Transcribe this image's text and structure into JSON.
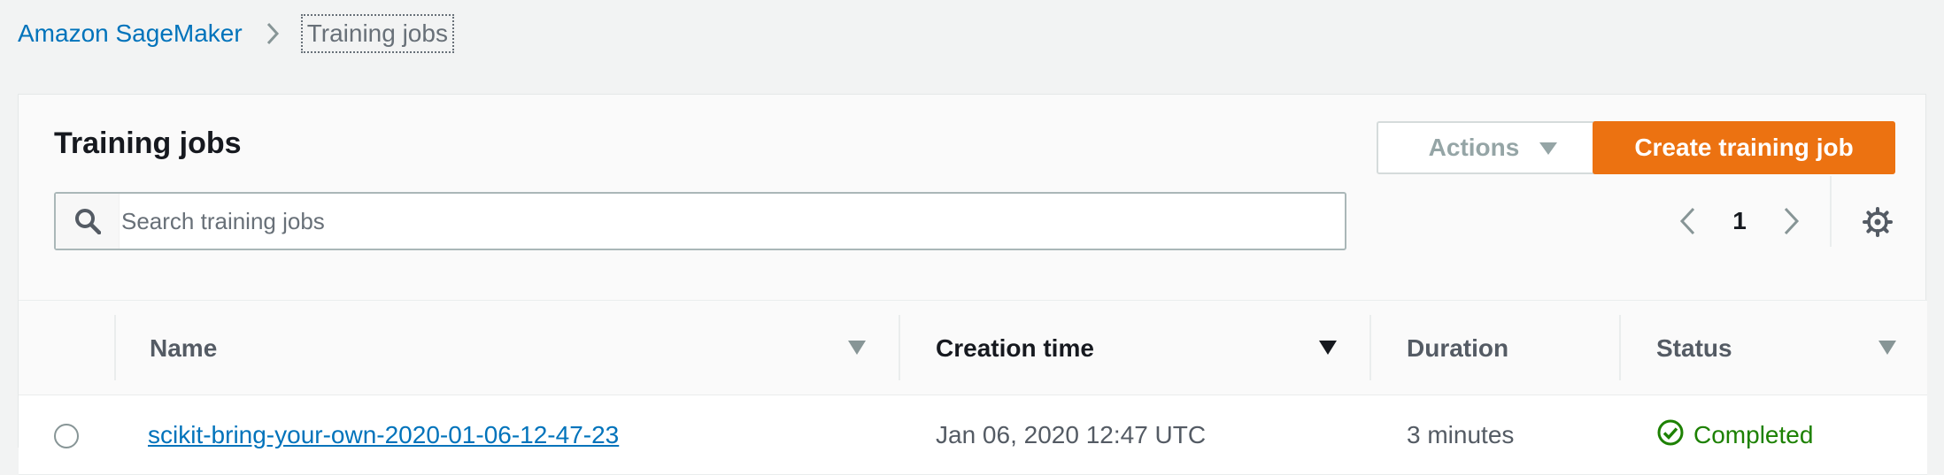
{
  "breadcrumb": {
    "root": "Amazon SageMaker",
    "current": "Training jobs"
  },
  "panel": {
    "title": "Training jobs",
    "actions_label": "Actions",
    "create_label": "Create training job"
  },
  "search": {
    "placeholder": "Search training jobs",
    "value": ""
  },
  "pagination": {
    "current_page": "1"
  },
  "table": {
    "columns": [
      "Name",
      "Creation time",
      "Duration",
      "Status"
    ],
    "sorted_column": "Creation time",
    "rows": [
      {
        "name": "scikit-bring-your-own-2020-01-06-12-47-23",
        "creation_time": "Jan 06, 2020 12:47 UTC",
        "duration": "3 minutes",
        "status": "Completed"
      }
    ]
  },
  "colors": {
    "link": "#0073bb",
    "primary": "#ec7211",
    "success": "#1d8102",
    "background": "#f2f3f3"
  },
  "icons": {
    "breadcrumb_separator": "chevron-right-icon",
    "actions": "caret-down-icon",
    "search": "search-icon",
    "pager_prev": "chevron-left-icon",
    "pager_next": "chevron-right-icon",
    "settings": "gear-icon",
    "status": "check-circle-icon"
  }
}
